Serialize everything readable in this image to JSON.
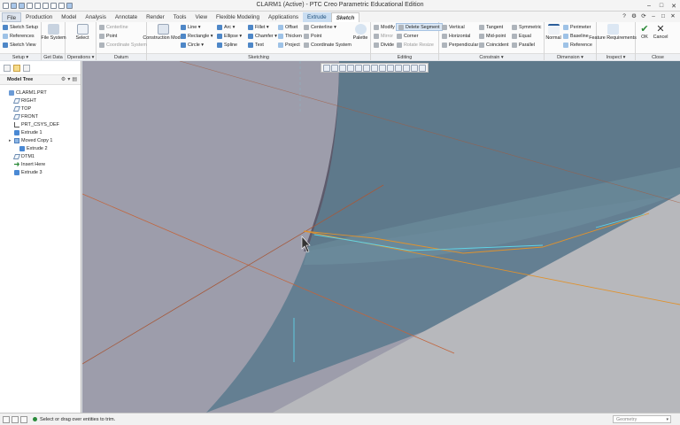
{
  "window": {
    "title": "CLARM1 (Active) - PTC Creo Parametric Educational Edition",
    "controls": [
      "–",
      "□",
      "✕"
    ]
  },
  "menu": {
    "tabs": [
      "File",
      "Production",
      "Model",
      "Analysis",
      "Annotate",
      "Render",
      "Tools",
      "View",
      "Flexible Modeling",
      "Applications",
      "Extrude",
      "Sketch"
    ],
    "right_icons": [
      "?",
      "⚙",
      "⟳",
      "–",
      "□",
      "✕"
    ]
  },
  "ribbon": {
    "setup": {
      "label": "Setup ▾",
      "items": [
        "Sketch Setup",
        "References",
        "Sketch View"
      ]
    },
    "get_data": {
      "label": "Get Data",
      "file_system": "File System"
    },
    "operations": {
      "label": "Operations ▾",
      "select": "Select"
    },
    "datum": {
      "label": "Datum",
      "items": [
        "Centerline",
        "Point",
        "Coordinate System"
      ]
    },
    "sketching": {
      "label": "Sketching",
      "construction_mode": "Construction Mode",
      "col1": [
        "Line ▾",
        "Rectangle ▾",
        "Circle ▾"
      ],
      "col2": [
        "Arc ▾",
        "Ellipse ▾",
        "Spline"
      ],
      "col3": [
        "Fillet ▾",
        "Chamfer ▾",
        "Text"
      ],
      "col4": [
        "Offset",
        "Thicken",
        "Project"
      ],
      "col5": [
        "Centerline ▾",
        "Point",
        "Coordinate System"
      ],
      "palette": "Palette"
    },
    "editing": {
      "label": "Editing",
      "col1": [
        "Modify",
        "Mirror",
        "Divide"
      ],
      "col2": [
        "Delete Segment",
        "Corner",
        "Rotate Resize"
      ]
    },
    "constrain": {
      "label": "Constrain ▾",
      "col1": [
        "Vertical",
        "Horizontal",
        "Perpendicular"
      ],
      "col2": [
        "Tangent",
        "Mid-point",
        "Coincident"
      ],
      "col3": [
        "Symmetric",
        "Equal",
        "Parallel"
      ]
    },
    "dimension": {
      "label": "Dimension ▾",
      "normal": "Normal",
      "items": [
        "Perimeter",
        "Baseline",
        "Reference"
      ]
    },
    "inspect": {
      "label": "Inspect ▾",
      "feature_requirements": "Feature Requirements"
    },
    "close": {
      "label": "Close",
      "ok": "OK",
      "cancel": "Cancel"
    }
  },
  "model_tree": {
    "header": "Model Tree",
    "items": [
      {
        "label": "CLARM1.PRT",
        "icon": "part-icon",
        "indent": 0,
        "expand": ""
      },
      {
        "label": "RIGHT",
        "icon": "datum-plane-icon",
        "indent": 1,
        "expand": ""
      },
      {
        "label": "TOP",
        "icon": "datum-plane-icon",
        "indent": 1,
        "expand": ""
      },
      {
        "label": "FRONT",
        "icon": "datum-plane-icon",
        "indent": 1,
        "expand": ""
      },
      {
        "label": "PRT_CSYS_DEF",
        "icon": "csys-icon",
        "indent": 1,
        "expand": ""
      },
      {
        "label": "Extrude 1",
        "icon": "extrude-icon",
        "indent": 1,
        "expand": ""
      },
      {
        "label": "Moved Copy 1",
        "icon": "copy-icon",
        "indent": 1,
        "expand": "▸"
      },
      {
        "label": "Extrude 2",
        "icon": "extrude-icon",
        "indent": 2,
        "expand": ""
      },
      {
        "label": "DTM1",
        "icon": "datum-plane-icon",
        "indent": 1,
        "expand": ""
      },
      {
        "label": "Insert Here",
        "icon": "insert-arrow-icon",
        "indent": 1,
        "expand": ""
      },
      {
        "label": "Extrude 3",
        "icon": "extrude-icon",
        "indent": 1,
        "expand": ""
      }
    ]
  },
  "status": {
    "message": "Select or drag over entities to trim.",
    "filter": "Geometry"
  },
  "colors": {
    "viewport_background": "#9d9dab",
    "dark_face": "#5d5a6b",
    "blue_face": "#5e7c8f",
    "light_face": "#b7b8bc",
    "datum_line": "#c2653c",
    "sketch_orange": "#e0922d",
    "sketch_cyan": "#5fd3e6"
  }
}
